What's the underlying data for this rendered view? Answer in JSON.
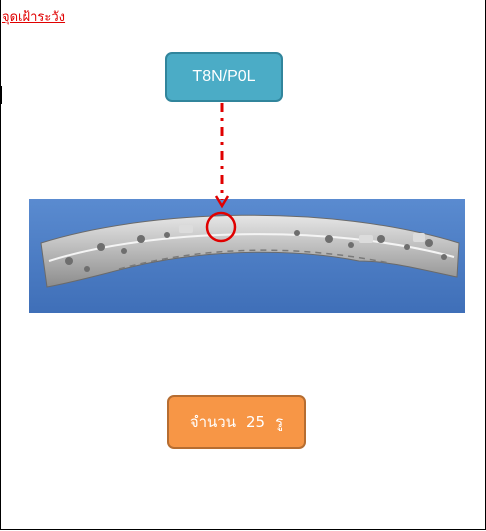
{
  "header": {
    "caution_label": "จุดเฝ้าระวัง"
  },
  "code_box": {
    "label": "T8N/P0L"
  },
  "count_box": {
    "prefix": "จำนวน",
    "value": "25",
    "unit": "รู"
  },
  "colors": {
    "caution_text": "#e00000",
    "code_box_fill": "#4bacc6",
    "count_box_fill": "#f79646",
    "pointer_line": "#e00000",
    "photo_background": "#4f7fc4"
  },
  "icons": {
    "pointer": "dashed-arrow-down",
    "highlight": "red-circle"
  }
}
